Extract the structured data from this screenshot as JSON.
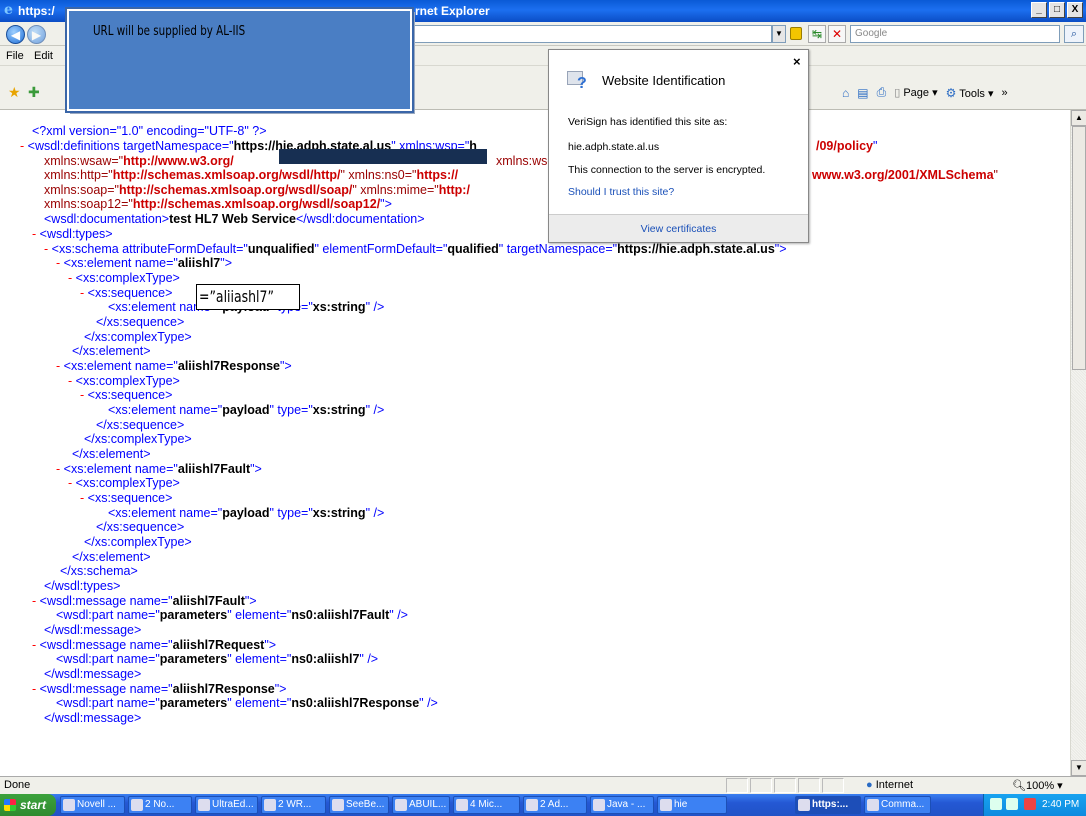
{
  "window": {
    "title_left": "https:/",
    "title_right": "rnet Explorer",
    "min": "_",
    "max": "□",
    "close": "X"
  },
  "address": {
    "search_placeholder": "Google"
  },
  "menu": {
    "file": "File",
    "edit": "Edit"
  },
  "toolbar": {
    "page": "Page",
    "tools": "Tools",
    "more": "»"
  },
  "note_overlay": {
    "text": "URL will be supplied by AL-IIS"
  },
  "callout_overlay": {
    "text": "=”aliiashl7”"
  },
  "popup": {
    "title": "Website Identification",
    "close": "×",
    "line1": "VeriSign has identified this site as:",
    "line2": "hie.adph.state.al.us",
    "line3": "This connection to the server is encrypted.",
    "link": "Should I trust this site?",
    "footer": "View certificates"
  },
  "xml": {
    "l1": "<?xml version=\"1.0\" encoding=\"UTF-8\" ?>",
    "l2a": "- ",
    "l2b": "<wsdl:definitions targetNamespace=\"",
    "l2c": "https://hie.adph.state.al.us",
    "l2d": "\" xmlns:wsp=\"",
    "l2e": "h",
    "l2f": "/09/policy",
    "l2g": "\"",
    "l3a": "xmlns:wsaw=\"",
    "l3b": "http://www.w3.org/",
    "l3c": "xmlns:wsdl=\"",
    "l4a": "xmlns:http=\"",
    "l4b": "http://schemas.xmlsoap.org/wsdl/http/",
    "l4c": "\" xmlns:ns0=\"",
    "l4d": "https://",
    "l4e": "www.w3.org/2001/XMLSchema",
    "l4f": "\"",
    "l5a": "xmlns:soap=\"",
    "l5b": "http://schemas.xmlsoap.org/wsdl/soap/",
    "l5c": "\" xmlns:mime=\"",
    "l5d": "http:/",
    "l6a": "xmlns:soap12=\"",
    "l6b": "http://schemas.xmlsoap.org/wsdl/soap12/",
    "l6c": "\">",
    "l7a": "<wsdl:documentation>",
    "l7b": "test HL7 Web Service",
    "l7c": "</wsdl:documentation>",
    "types": "<wsdl:types>",
    "schema_a": "<xs:schema attributeFormDefault=\"",
    "schema_b": "unqualified",
    "schema_c": "\" elementFormDefault=\"",
    "schema_d": "qualified",
    "schema_e": "\" targetNamespace=\"",
    "schema_f": "https://hie.adph.state.al.us",
    "schema_g": "\">",
    "el_open": "<xs:element name=\"",
    "el_close_q": "\">",
    "el1": "aliishl7",
    "el2": "aliishl7Response",
    "el3": "aliishl7Fault",
    "ct_open": "<xs:complexType>",
    "seq_open": "<xs:sequence>",
    "pl_a": "<xs:element name=\"",
    "pl_b": "payload",
    "pl_c": "\" type=\"",
    "pl_d": "xs:string",
    "pl_e": "\" />",
    "seq_close": "</xs:sequence>",
    "ct_close": "</xs:complexType>",
    "el_close": "</xs:element>",
    "schema_close": "</xs:schema>",
    "types_close": "</wsdl:types>",
    "msg_open": "<wsdl:message name=\"",
    "msg1": "aliishl7Fault",
    "msg2": "aliishl7Request",
    "msg3": "aliishl7Response",
    "part_a": "<wsdl:part name=\"",
    "part_b": "parameters",
    "part_c": "\" element=\"",
    "part1": "ns0:aliishl7Fault",
    "part2": "ns0:aliishl7",
    "part3": "ns0:aliishl7Response",
    "part_e": "\" />",
    "msg_close": "</wsdl:message>",
    "dash": "- "
  },
  "status": {
    "done": "Done",
    "zone": "Internet",
    "zoom": "100%"
  },
  "taskbar": {
    "start": "start",
    "tasks": [
      "Novell ...",
      "2 No...",
      "UltraEd...",
      "2 WR...",
      "SeeBe...",
      "ABUIL...",
      "4 Mic...",
      "2 Ad...",
      "Java - ...",
      "hie",
      "https:...",
      "Comma..."
    ],
    "time": "2:40 PM"
  }
}
